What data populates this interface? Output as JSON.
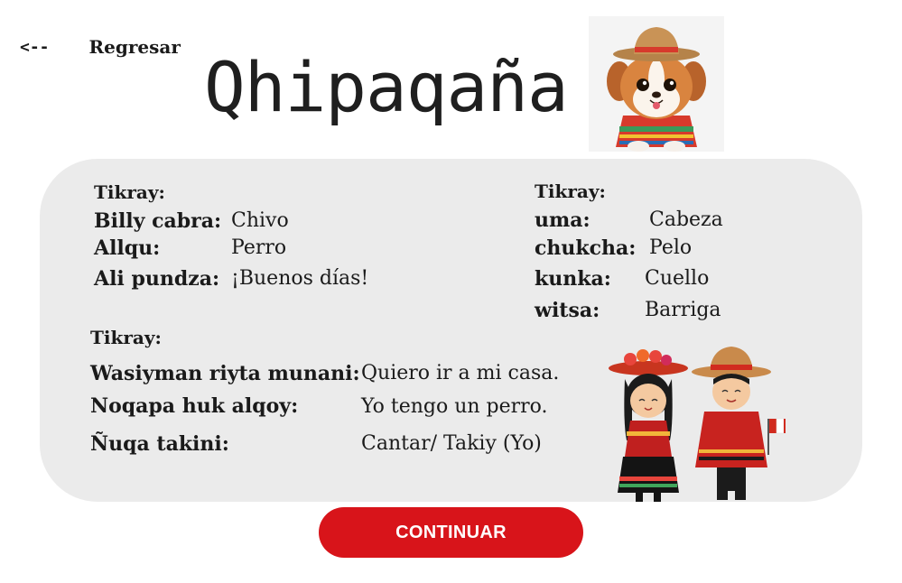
{
  "nav": {
    "back_arrow": "<--",
    "back_label": "Regresar"
  },
  "title": "Qhipaqaña",
  "block1": {
    "heading": "Tikray:",
    "rows": [
      {
        "term": "Billy cabra:",
        "meaning": "Chivo"
      },
      {
        "term": "Allqu:",
        "meaning": "Perro"
      },
      {
        "term": "Ali pundza:",
        "meaning": "¡Buenos días!"
      }
    ]
  },
  "block2": {
    "heading": "Tikray:",
    "rows": [
      {
        "term": "uma:",
        "meaning": "Cabeza"
      },
      {
        "term": "chukcha:",
        "meaning": "Pelo"
      },
      {
        "term": "kunka:",
        "meaning": "Cuello"
      },
      {
        "term": "witsa:",
        "meaning": "Barriga"
      }
    ]
  },
  "block3": {
    "heading": "Tikray:",
    "rows": [
      {
        "term": "Wasiyman riyta munani:",
        "meaning": "Quiero ir a mi casa."
      },
      {
        "term": "Noqapa huk alqoy:",
        "meaning": "Yo tengo un perro."
      },
      {
        "term": "Ñuqa takini:",
        "meaning": "Cantar/ Takiy (Yo)"
      }
    ]
  },
  "button": {
    "label": "CONTINUAR"
  },
  "colors": {
    "accent": "#d8141a",
    "panel": "#ebebeb"
  }
}
